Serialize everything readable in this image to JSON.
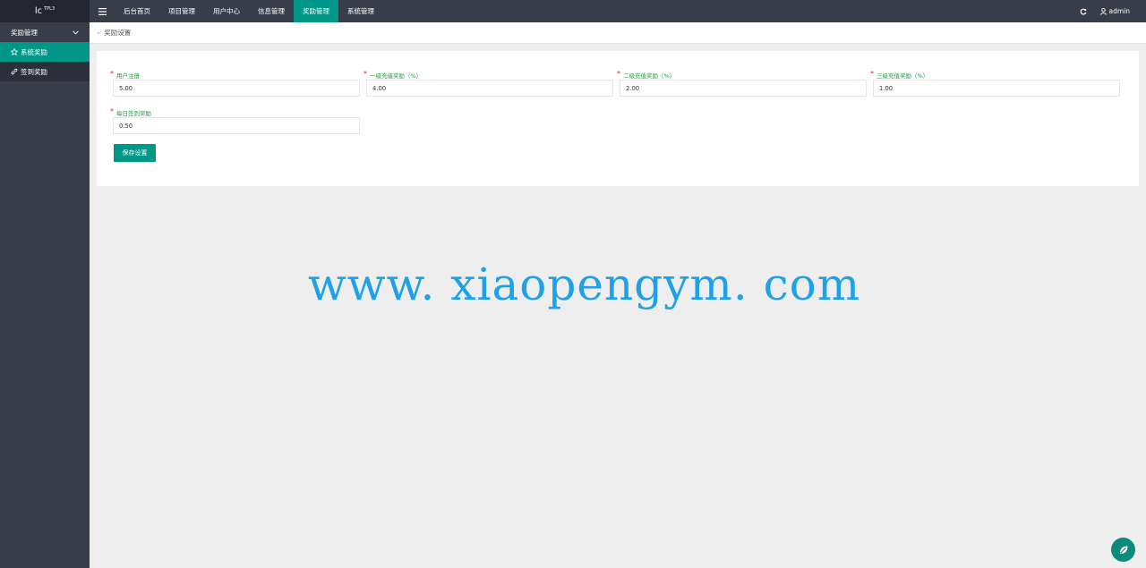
{
  "header": {
    "logo_text": "lc",
    "logo_version": "TPL3",
    "menu_icon": "hamburger-icon",
    "nav": [
      {
        "label": "后台首页"
      },
      {
        "label": "项目管理"
      },
      {
        "label": "用户中心"
      },
      {
        "label": "信息管理"
      },
      {
        "label": "奖励管理",
        "active": true
      },
      {
        "label": "系统管理"
      }
    ],
    "refresh_icon": "refresh-icon",
    "user_icon": "user-icon",
    "username": "admin"
  },
  "sidebar": {
    "group_label": "奖励管理",
    "group_icon": "chevron-down-icon",
    "items": [
      {
        "label": "系统奖励",
        "icon": "star-icon",
        "active": true
      },
      {
        "label": "签到奖励",
        "icon": "link-icon",
        "active": false
      }
    ]
  },
  "breadcrumb": {
    "separator": "»",
    "current": "奖励设置"
  },
  "form": {
    "fields": [
      {
        "label": "用户注册",
        "value": "5.00"
      },
      {
        "label": "一级充值奖励（%）",
        "value": "4.00"
      },
      {
        "label": "二级充值奖励（%）",
        "value": "2.00"
      },
      {
        "label": "三级充值奖励（%）",
        "value": "1.00"
      },
      {
        "label": "每日签到奖励",
        "value": "0.50"
      }
    ],
    "required_mark": "*",
    "save_label": "保存设置"
  },
  "watermark": {
    "text": "www. xiaopengym. com"
  },
  "float_button": {
    "icon": "leaf-icon"
  },
  "colors": {
    "accent": "#009688",
    "topbar": "#393d49",
    "label_green": "#1e9e3e",
    "required_red": "#e0211f",
    "watermark_blue": "#1da1e8"
  }
}
